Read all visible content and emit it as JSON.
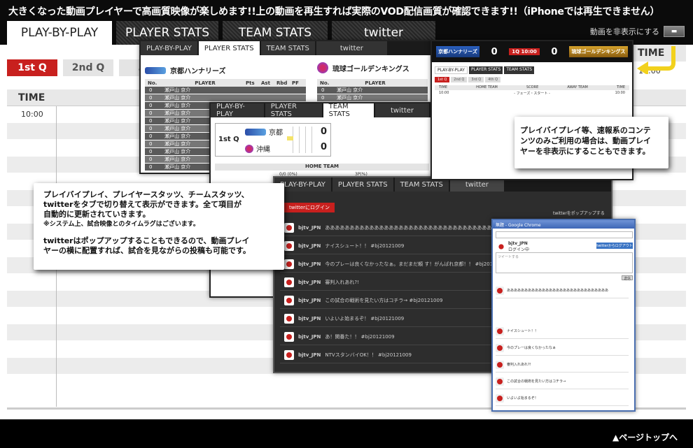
{
  "banner": "大きくなった動画プレイヤーで高画質映像が楽しめます!!上の動画を再生すれば実際のVOD配信画質が確認できます!!（iPhoneでは再生できません）",
  "main_tabs": [
    "PLAY-BY-PLAY",
    "PLAYER STATS",
    "TEAM STATS",
    "twitter"
  ],
  "hide_video_label": "動画を非表示にする",
  "quarters": [
    "1st Q",
    "2nd Q",
    "3r"
  ],
  "timetable": {
    "header": "TIME",
    "first_time": "10:00"
  },
  "right_time": {
    "header": "TIME",
    "first_time": "10:00"
  },
  "panel_player": {
    "tabs": [
      "PLAY-BY-PLAY",
      "PLAYER STATS",
      "TEAM STATS",
      "twitter"
    ],
    "team_home": "京都ハンナリーズ",
    "team_away": "琉球ゴールデンキングス",
    "headers": [
      "No.",
      "PLAYER",
      "Pts",
      "Ast",
      "Rbd",
      "PF"
    ],
    "away_headers": [
      "No.",
      "PLAYER"
    ],
    "row_text": "瀬戸山 京介",
    "row_no": "0",
    "row_val": "0"
  },
  "panel_team": {
    "tabs": [
      "PLAY-BY-PLAY",
      "PLAYER STATS",
      "TEAM STATS",
      "twitter"
    ],
    "quarter": "1st Q",
    "team1": "京都",
    "team2": "沖縄",
    "score1": "0",
    "score2": "0",
    "home_team_label": "HOME TEAM",
    "stat_label": "0/0 (0%)",
    "three_label": "3P(%)"
  },
  "panel_twitter": {
    "tabs": [
      "PLAY-BY-PLAY",
      "PLAYER STATS",
      "TEAM STATS",
      "twitter"
    ],
    "login": "twitterにログイン",
    "popup_link": "twitterをポップアップする",
    "tweets": [
      {
        "user": "bjtv_JPN",
        "text": "あああああああああああああああああああああああああああああああああああああああああああああ #bj20121009"
      },
      {
        "user": "bjtv_JPN",
        "text": "ナイスシュート！！ #bj20121009"
      },
      {
        "user": "bjtv_JPN",
        "text": "今のプレーは良くなかったなぁ。まだまだ頼 す！がんばれ京都！！ #bj20121009"
      },
      {
        "user": "bjtv_JPN",
        "text": "審判入れあれ?!"
      },
      {
        "user": "bjtv_JPN",
        "text": "この試合の戦術を見たい方はコチラ→ #bj20121009"
      },
      {
        "user": "bjtv_JPN",
        "text": "いよいよ始まるぞ！ #bj20121009"
      },
      {
        "user": "bjtv_JPN",
        "text": "あ！関番た！！ #bj20121009"
      },
      {
        "user": "bjtv_JPN",
        "text": "NTVスタンバイOK！！ #bj20121009"
      }
    ]
  },
  "popup": {
    "title": "無題 - Google Chrome",
    "user": "bjtv_JPN",
    "login_status": "ログイン中",
    "login_btn": "twitterからログアウト",
    "tweet_placeholder": "ツイートする",
    "submit": "送信",
    "tweets": [
      "あああああああああああああああああああああああああああああ",
      "ナイスシュート！！",
      "今のプレーは良くなかったなぁ",
      "審判入れあれ?!",
      "この試合の戦術を見たい方はコチラ→",
      "いよいよ始まるぞ！"
    ]
  },
  "mini": {
    "team1": "京都ハンナリーズ",
    "team2": "琉球ゴールデンキングス",
    "score1": "0",
    "score2": "0",
    "clock": "1Q 10:00",
    "tabs": [
      "PLAY-BY-PLAY",
      "PLAYER STATS",
      "TEAM STATS"
    ],
    "quarters": [
      "1st Q",
      "2nd Q",
      "3rd Q",
      "4th Q"
    ],
    "cols": [
      "TIME",
      "HOME TEAM",
      "SCORE",
      "AWAY TEAM",
      "TIME"
    ],
    "row_time": "10:00",
    "row_text": "- フェーズ・スタート -"
  },
  "callout1": {
    "line1": "プレイバイプレイ、プレイヤースタッツ、チームスタッツ、",
    "line2": "twitterをタブで切り替えて表示ができます。全て項目が",
    "line3": "自動的に更新されていきます。",
    "note": "※システム上、試合映像とのタイムラグはございます。",
    "line4": "twitterはポップアップすることもできるので、動画プレイ",
    "line5": "ヤーの横に配置すれば、試合を見ながらの投稿も可能です。"
  },
  "callout2": {
    "line1": "プレイバイプレイ等、速報系のコンテ",
    "line2": "ンツのみご利用の場合は、動画プレイ",
    "line3": "ヤーを非表示にすることもできます。"
  },
  "pagetop": "▲ページトップへ",
  "colors": {
    "accent": "#c8201e",
    "arrow": "#f2d11d"
  }
}
